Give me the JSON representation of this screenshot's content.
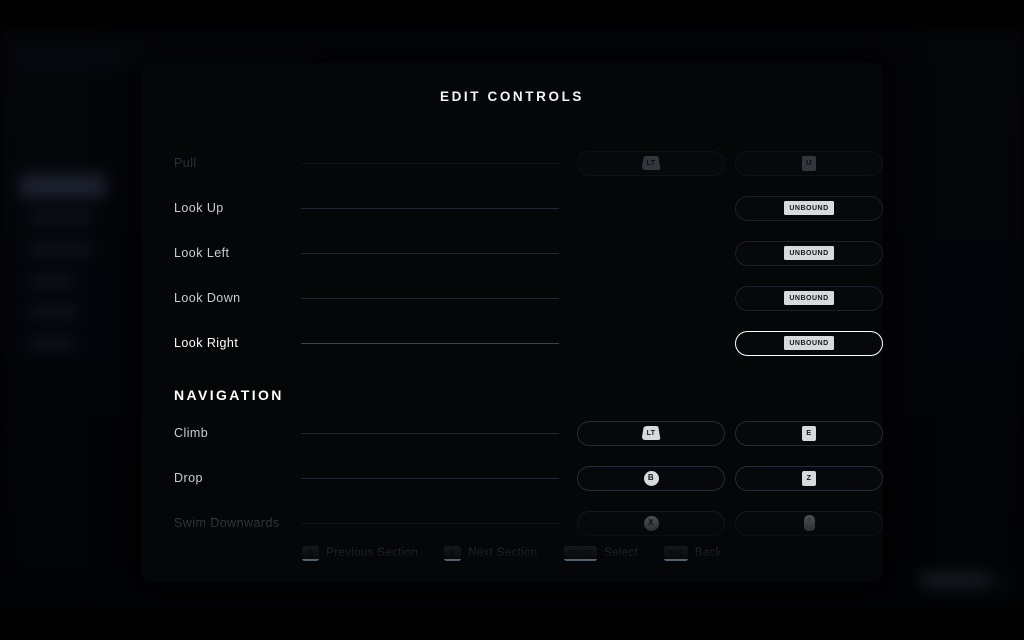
{
  "background": {
    "sidebar_items": [
      "",
      "",
      "",
      "",
      "",
      ""
    ],
    "note": "blurred out-of-focus menu behind modal"
  },
  "panel": {
    "title": "EDIT CONTROLS"
  },
  "rows": [
    {
      "label": "Pull",
      "state": "faint",
      "bindings": [
        {
          "kind": "trigger",
          "text": "LT"
        },
        {
          "kind": "key",
          "text": "U"
        }
      ]
    },
    {
      "label": "Look Up",
      "state": "normal",
      "bindings": [
        {
          "kind": "none",
          "text": ""
        },
        {
          "kind": "unbound",
          "text": "UNBOUND"
        }
      ]
    },
    {
      "label": "Look Left",
      "state": "normal",
      "bindings": [
        {
          "kind": "none",
          "text": ""
        },
        {
          "kind": "unbound",
          "text": "UNBOUND"
        }
      ]
    },
    {
      "label": "Look Down",
      "state": "normal",
      "bindings": [
        {
          "kind": "none",
          "text": ""
        },
        {
          "kind": "unbound",
          "text": "UNBOUND"
        }
      ]
    },
    {
      "label": "Look Right",
      "state": "active",
      "bindings": [
        {
          "kind": "none",
          "text": ""
        },
        {
          "kind": "unbound",
          "text": "UNBOUND"
        }
      ]
    }
  ],
  "section": {
    "heading": "NAVIGATION",
    "rows": [
      {
        "label": "Climb",
        "state": "normal",
        "bindings": [
          {
            "kind": "trigger",
            "text": "LT"
          },
          {
            "kind": "key",
            "text": "E"
          }
        ]
      },
      {
        "label": "Drop",
        "state": "normal",
        "bindings": [
          {
            "kind": "pad",
            "text": "B"
          },
          {
            "kind": "key",
            "text": "Z"
          }
        ]
      },
      {
        "label": "Swim Downwards",
        "state": "dim",
        "bindings": [
          {
            "kind": "pad",
            "text": "X"
          },
          {
            "kind": "mouse",
            "text": ""
          }
        ]
      }
    ]
  },
  "footer": {
    "hints": [
      {
        "key": "Q",
        "label": "Previous Section"
      },
      {
        "key": "E",
        "label": "Next Section"
      },
      {
        "key": "SPACE",
        "label": "Select"
      },
      {
        "key": "ESC",
        "label": "Back"
      }
    ]
  },
  "colors": {
    "panel_bg": "#050607",
    "screen_bg": "#000000",
    "label": "#c9cdd4",
    "label_active": "#ffffff",
    "badge_bg": "#d7d9dc",
    "hint_key_bg": "#59616f",
    "slot_border": "#252b36",
    "slot_border_active": "#ffffff"
  }
}
